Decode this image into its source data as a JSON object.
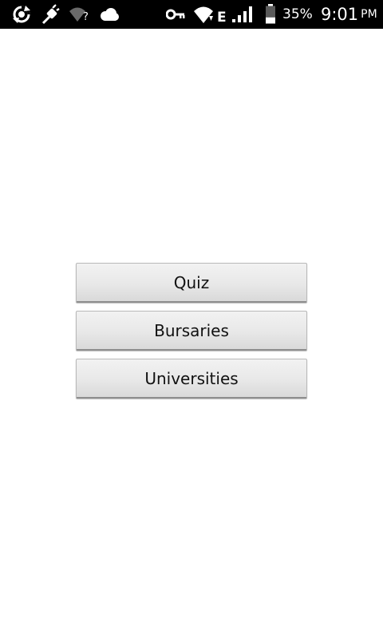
{
  "status_bar": {
    "background": "#000000",
    "left_icons": [
      "sync-icon",
      "usb-debug-icon",
      "wifi-unknown-icon",
      "cloud-icon"
    ],
    "right_icons": [
      "vpn-key-icon",
      "wifi-icon",
      "signal-icon",
      "battery-icon"
    ],
    "network_type": "E",
    "wifi_badge": "?",
    "battery_percent": "35%",
    "battery_level": 0.35,
    "clock_time": "9:01",
    "clock_ampm": "PM"
  },
  "menu": {
    "buttons": [
      {
        "label": "Quiz"
      },
      {
        "label": "Bursaries"
      },
      {
        "label": "Universities"
      }
    ]
  }
}
